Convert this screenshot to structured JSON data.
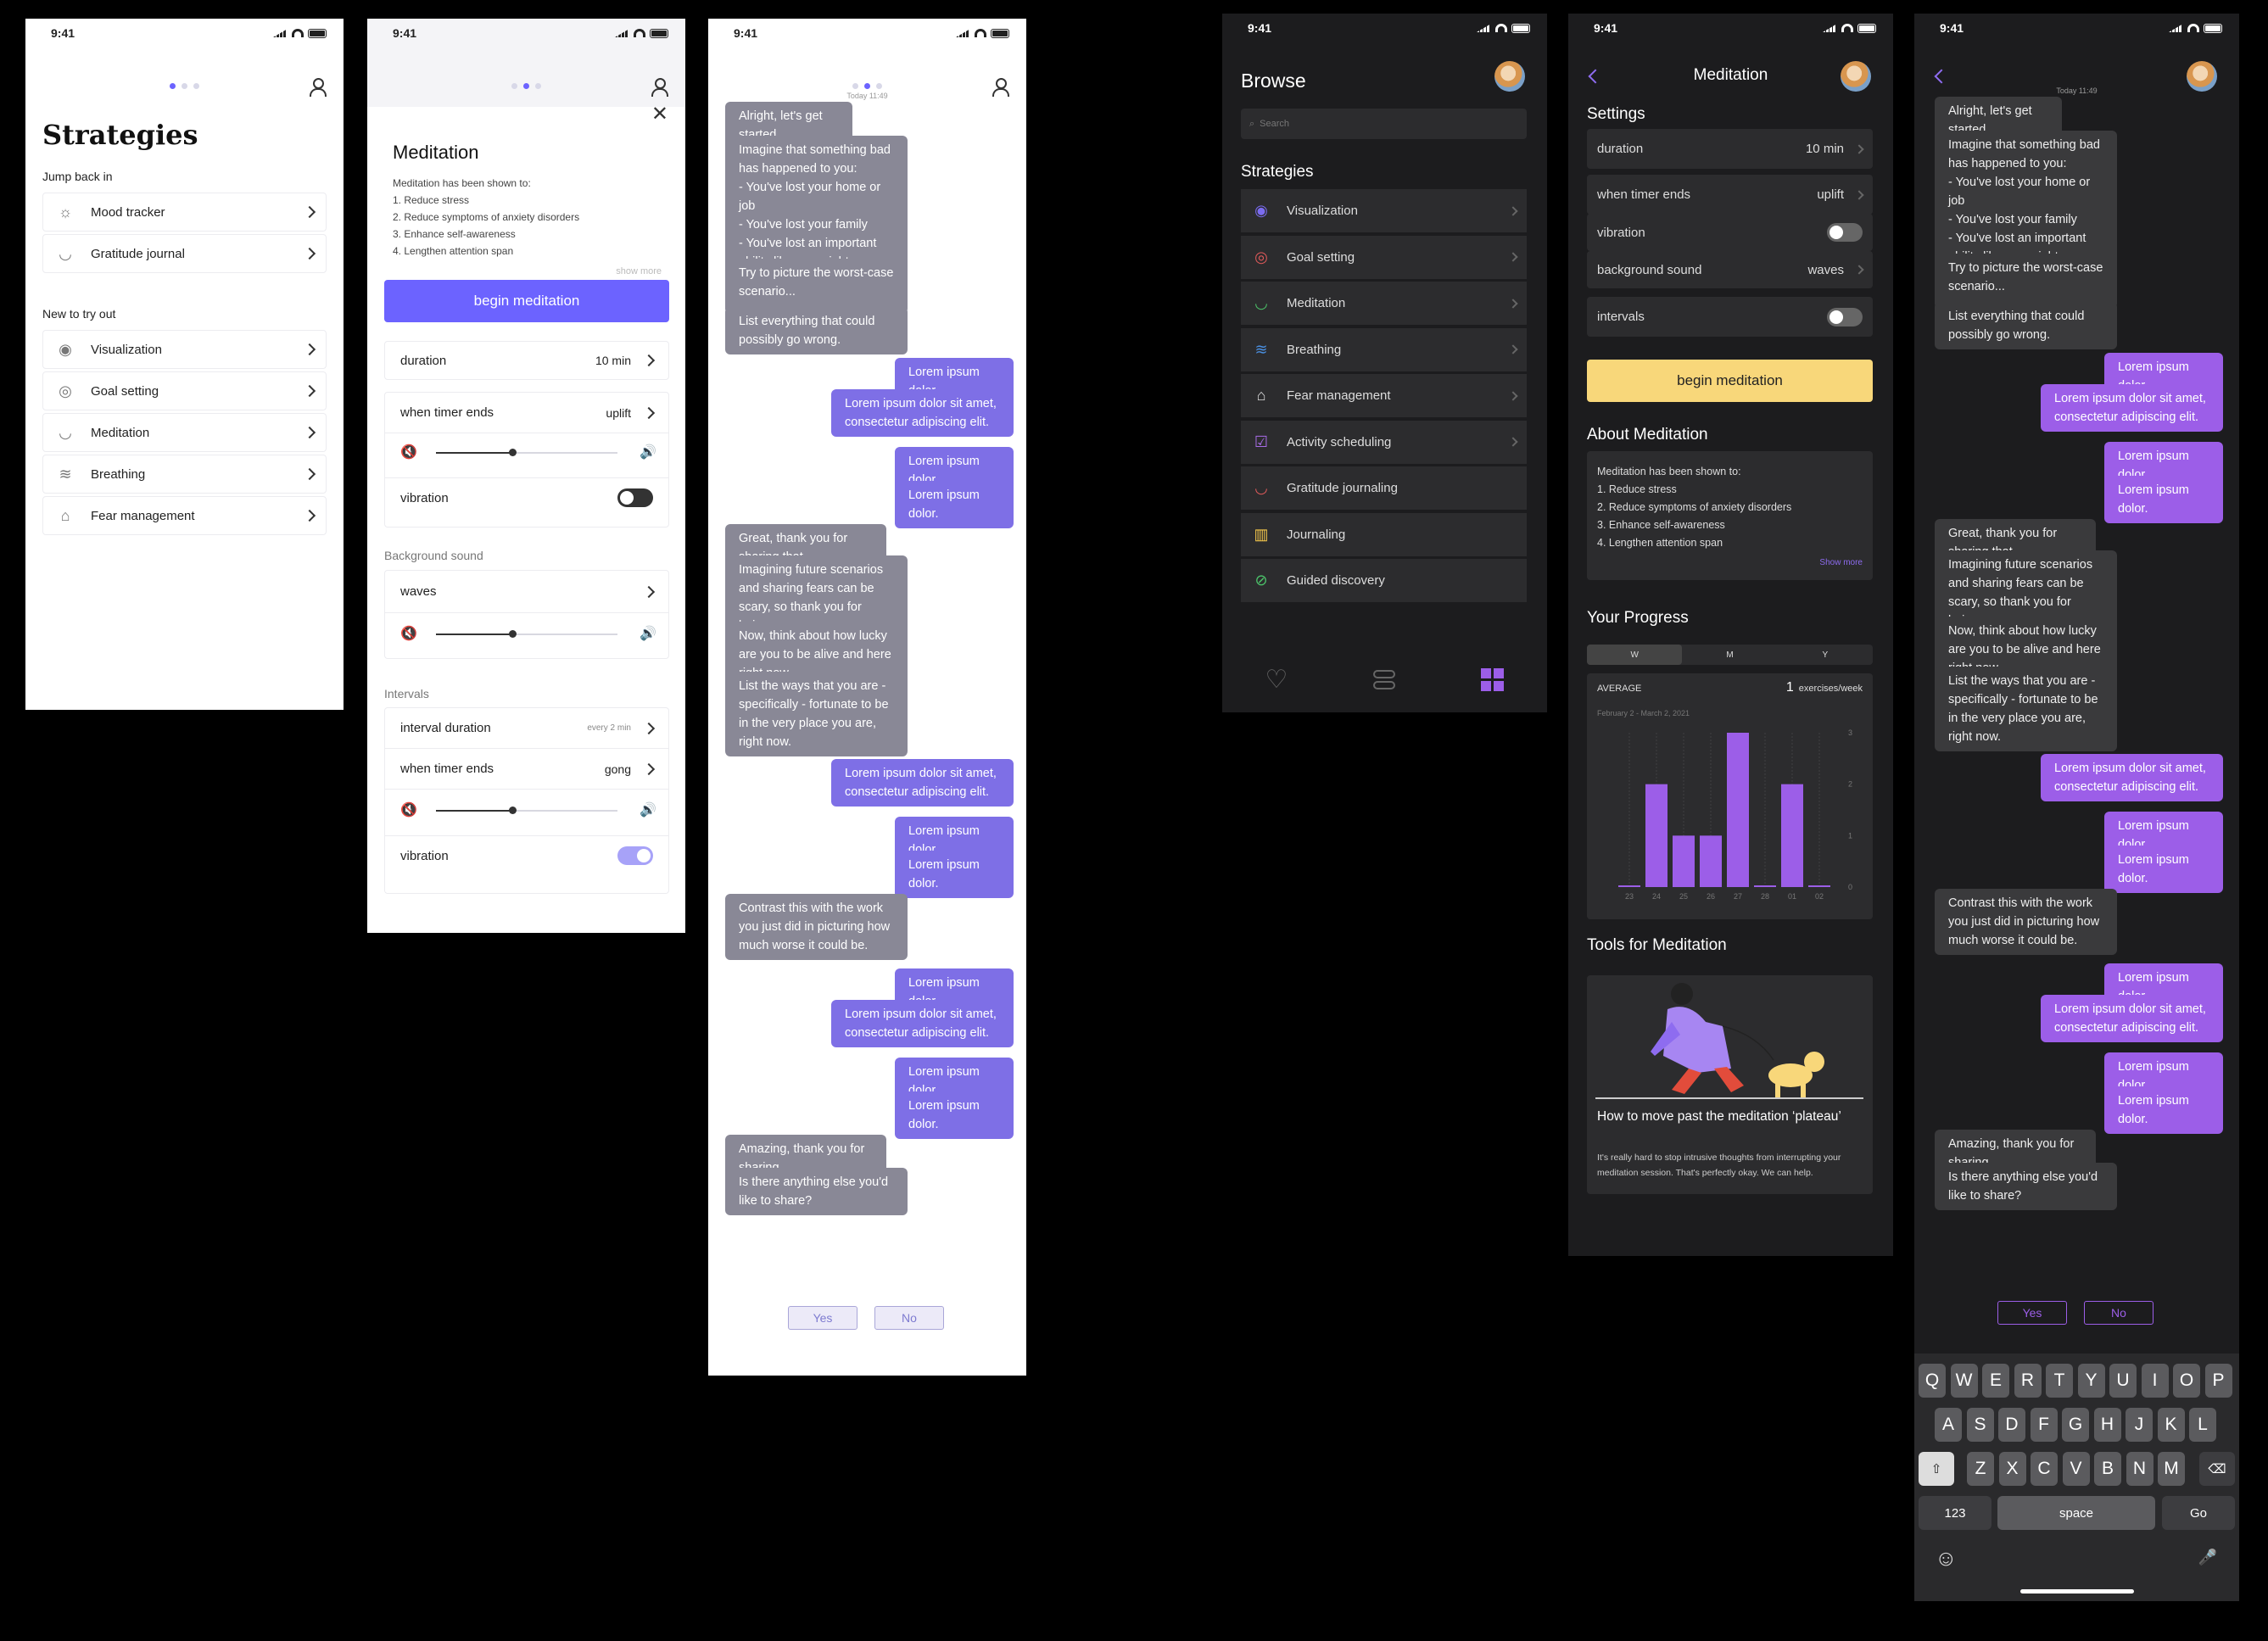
{
  "status_time": "9:41",
  "s1": {
    "title": "Strategies",
    "jump_back": "Jump back in",
    "jump_items": [
      {
        "label": "Mood tracker",
        "icon": "sun-icon"
      },
      {
        "label": "Gratitude journal",
        "icon": "lips-icon"
      }
    ],
    "new_title": "New to try out",
    "new_items": [
      {
        "label": "Visualization",
        "icon": "eye-icon"
      },
      {
        "label": "Goal setting",
        "icon": "target-icon"
      },
      {
        "label": "Meditation",
        "icon": "bowl-icon"
      },
      {
        "label": "Breathing",
        "icon": "wind-icon"
      },
      {
        "label": "Fear management",
        "icon": "ghost-icon"
      }
    ]
  },
  "s2": {
    "title": "Meditation",
    "desc_intro": "Meditation has been shown to:",
    "desc_items": [
      "1. Reduce stress",
      "2. Reduce symptoms of anxiety disorders",
      "3. Enhance self-awareness",
      "4. Lengthen attention span"
    ],
    "show_more": "show more",
    "begin": "begin meditation",
    "duration_label": "duration",
    "duration_value": "10 min",
    "timer_label": "when timer ends",
    "timer_value": "uplift",
    "vibration": "vibration",
    "bg_sound_title": "Background sound",
    "bg_sound_value": "waves",
    "intervals_title": "Intervals",
    "interval_label": "interval duration",
    "interval_value": "every 2 min",
    "timer2_label": "when timer ends",
    "timer2_value": "gong",
    "vibration2": "vibration",
    "slider1": 0.42,
    "slider2": 0.42,
    "slider3": 0.42,
    "vibration_on": false,
    "vibration2_on": true
  },
  "chat": {
    "timestamp": "Today 11:49",
    "messages": [
      "Alright, let's get started.",
      "Imagine that something bad has happened to you:\n- You've lost your home or job\n- You've lost your family\n- You've lost an important ability like your sight or your ability to communicate with others",
      "Try to picture the worst-case scenario...",
      "List everything that could possibly go wrong.",
      "Lorem ipsum dolor.",
      "Lorem ipsum dolor sit amet, consectetur adipiscing elit.",
      "Lorem ipsum dolor.",
      "Lorem ipsum dolor.",
      "Great, thank you for sharing that.",
      "Imagining future scenarios and sharing fears can be scary, so thank you for being open.",
      "Now, think about how lucky are you to be alive and here right now.",
      "List the ways that you are - specifically - fortunate to be in the very place you are, right now.",
      "Lorem ipsum dolor sit amet, consectetur adipiscing elit.",
      "Lorem ipsum dolor.",
      "Lorem ipsum dolor.",
      "Contrast this with the work you just did in picturing how much worse it could be.",
      "Lorem ipsum dolor.",
      "Lorem ipsum dolor sit amet, consectetur adipiscing elit.",
      "Lorem ipsum dolor.",
      "Lorem ipsum dolor.",
      "Amazing, thank you for sharing.",
      "Is there anything else you'd like to share?"
    ],
    "yes": "Yes",
    "no": "No"
  },
  "s4": {
    "title": "Browse",
    "search_placeholder": "Search",
    "section": "Strategies",
    "items": [
      {
        "label": "Visualization",
        "icon": "eye-icon",
        "color": "#7b6cf0"
      },
      {
        "label": "Goal setting",
        "icon": "target-icon",
        "color": "#e05a5a"
      },
      {
        "label": "Meditation",
        "icon": "bowl-icon",
        "color": "#4cc46a"
      },
      {
        "label": "Breathing",
        "icon": "wind-icon",
        "color": "#4a90e2"
      },
      {
        "label": "Fear management",
        "icon": "ghost-icon",
        "color": "#dddddd"
      },
      {
        "label": "Activity scheduling",
        "icon": "checkbox-icon",
        "color": "#a86ce8"
      },
      {
        "label": "Gratitude journaling",
        "icon": "lips-icon",
        "color": "#e05a5a"
      },
      {
        "label": "Journaling",
        "icon": "book-icon",
        "color": "#f3c64b"
      },
      {
        "label": "Guided discovery",
        "icon": "compass-icon",
        "color": "#4cc46a"
      }
    ]
  },
  "s5": {
    "title": "Meditation",
    "settings": "Settings",
    "rows": [
      {
        "label": "duration",
        "value": "10 min"
      },
      {
        "label": "when timer ends",
        "value": "uplift"
      },
      {
        "label": "vibration",
        "value": ""
      },
      {
        "label": "background sound",
        "value": "waves"
      },
      {
        "label": "intervals",
        "value": ""
      }
    ],
    "begin": "begin meditation",
    "about_title": "About Meditation",
    "about_intro": "Meditation has been shown to:",
    "about_items": [
      "1. Reduce stress",
      "2. Reduce symptoms of anxiety disorders",
      "3. Enhance self-awareness",
      "4. Lengthen attention span"
    ],
    "show_more": "Show more",
    "progress_title": "Your Progress",
    "tabs": [
      "W",
      "M",
      "Y"
    ],
    "average": "AVERAGE",
    "avg_value": "1",
    "avg_unit": "exercises/week",
    "date_range": "February 2 - March 2, 2021",
    "tools_title": "Tools for Meditation",
    "article_title": "How to move past the meditation ‘plateau’",
    "article_desc": "It's really hard to stop intrusive thoughts from interrupting your meditation session. That's perfectly okay. We can help.",
    "accent": "#f8d77a"
  },
  "chart_data": {
    "type": "bar",
    "categories": [
      "23",
      "24",
      "25",
      "26",
      "27",
      "28",
      "01",
      "02"
    ],
    "values": [
      0,
      2,
      1,
      1,
      3,
      0,
      2,
      0
    ],
    "ylim": [
      0,
      3
    ],
    "yticks": [
      "0",
      "1",
      "2",
      "3"
    ],
    "color": "#9c5ee8"
  },
  "keyboard": {
    "row1": [
      "Q",
      "W",
      "E",
      "R",
      "T",
      "Y",
      "U",
      "I",
      "O",
      "P"
    ],
    "row2": [
      "A",
      "S",
      "D",
      "F",
      "G",
      "H",
      "J",
      "K",
      "L"
    ],
    "row3": [
      "Z",
      "X",
      "C",
      "V",
      "B",
      "N",
      "M"
    ],
    "numbers": "123",
    "space": "space",
    "go": "Go"
  }
}
